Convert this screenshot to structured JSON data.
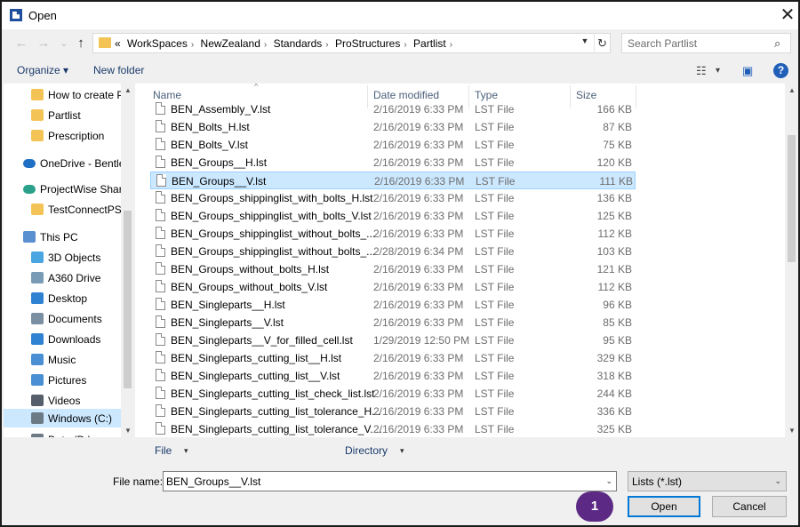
{
  "window": {
    "title": "Open",
    "close_glyph": "✕"
  },
  "nav_buttons": {
    "back": "←",
    "forward": "→",
    "recent": "⌄",
    "up": "↑"
  },
  "address": {
    "crumbs": [
      "WorkSpaces",
      "NewZealand",
      "Standards",
      "ProStructures",
      "Partlist"
    ],
    "overflow": "«",
    "refresh_glyph": "↻"
  },
  "search": {
    "placeholder": "Search Partlist",
    "icon_glyph": "⌕"
  },
  "toolbar": {
    "organize": "Organize ▾",
    "new_folder": "New folder",
    "view_glyph": "☷",
    "view_dd": "▾",
    "pane_glyph": "▣",
    "help": "?"
  },
  "sidebar": {
    "items": [
      {
        "label": "How to create Pr",
        "icon": "folder-icon",
        "color": "#f3c455"
      },
      {
        "label": "Partlist",
        "icon": "folder-icon",
        "color": "#f3c455"
      },
      {
        "label": "Prescription",
        "icon": "folder-icon",
        "color": "#f3c455"
      },
      {
        "label": "OneDrive - Bentley",
        "icon": "cloud-icon",
        "color": "#1f6fc4"
      },
      {
        "label": "ProjectWise Share",
        "icon": "cloud-icon",
        "color": "#2ba08a"
      },
      {
        "label": "TestConnectPS",
        "icon": "folder-icon",
        "color": "#f3c455"
      },
      {
        "label": "This PC",
        "icon": "computer-icon",
        "color": "#5a8fd0"
      },
      {
        "label": "3D Objects",
        "icon": "cube-icon",
        "color": "#4aa6e0"
      },
      {
        "label": "A360 Drive",
        "icon": "drive-icon",
        "color": "#7a9bb5"
      },
      {
        "label": "Desktop",
        "icon": "desktop-icon",
        "color": "#2f82d2"
      },
      {
        "label": "Documents",
        "icon": "documents-icon",
        "color": "#7b8fa3"
      },
      {
        "label": "Downloads",
        "icon": "download-icon",
        "color": "#2f82d2"
      },
      {
        "label": "Music",
        "icon": "music-icon",
        "color": "#4a8fd4"
      },
      {
        "label": "Pictures",
        "icon": "pictures-icon",
        "color": "#4a8fd4"
      },
      {
        "label": "Videos",
        "icon": "videos-icon",
        "color": "#555e6a"
      },
      {
        "label": "Windows (C:)",
        "icon": "hard-drive-icon",
        "color": "#6c7a86"
      },
      {
        "label": "Data (D:)",
        "icon": "hard-drive-icon",
        "color": "#6c7a86"
      }
    ],
    "selected_index": 15
  },
  "columns": {
    "name": "Name",
    "date": "Date modified",
    "type": "Type",
    "size": "Size",
    "sort_glyph": "^"
  },
  "files": [
    {
      "name": "BEN_Assembly_V.lst",
      "date": "2/16/2019 6:33 PM",
      "type": "LST File",
      "size": "166 KB"
    },
    {
      "name": "BEN_Bolts_H.lst",
      "date": "2/16/2019 6:33 PM",
      "type": "LST File",
      "size": "87 KB"
    },
    {
      "name": "BEN_Bolts_V.lst",
      "date": "2/16/2019 6:33 PM",
      "type": "LST File",
      "size": "75 KB"
    },
    {
      "name": "BEN_Groups__H.lst",
      "date": "2/16/2019 6:33 PM",
      "type": "LST File",
      "size": "120 KB"
    },
    {
      "name": "BEN_Groups__V.lst",
      "date": "2/16/2019 6:33 PM",
      "type": "LST File",
      "size": "111 KB"
    },
    {
      "name": "BEN_Groups_shippinglist_with_bolts_H.lst",
      "date": "2/16/2019 6:33 PM",
      "type": "LST File",
      "size": "136 KB"
    },
    {
      "name": "BEN_Groups_shippinglist_with_bolts_V.lst",
      "date": "2/16/2019 6:33 PM",
      "type": "LST File",
      "size": "125 KB"
    },
    {
      "name": "BEN_Groups_shippinglist_without_bolts_...",
      "date": "2/16/2019 6:33 PM",
      "type": "LST File",
      "size": "112 KB"
    },
    {
      "name": "BEN_Groups_shippinglist_without_bolts_...",
      "date": "2/28/2019 6:34 PM",
      "type": "LST File",
      "size": "103 KB"
    },
    {
      "name": "BEN_Groups_without_bolts_H.lst",
      "date": "2/16/2019 6:33 PM",
      "type": "LST File",
      "size": "121 KB"
    },
    {
      "name": "BEN_Groups_without_bolts_V.lst",
      "date": "2/16/2019 6:33 PM",
      "type": "LST File",
      "size": "112 KB"
    },
    {
      "name": "BEN_Singleparts__H.lst",
      "date": "2/16/2019 6:33 PM",
      "type": "LST File",
      "size": "96 KB"
    },
    {
      "name": "BEN_Singleparts__V.lst",
      "date": "2/16/2019 6:33 PM",
      "type": "LST File",
      "size": "85 KB"
    },
    {
      "name": "BEN_Singleparts__V_for_filled_cell.lst",
      "date": "1/29/2019 12:50 PM",
      "type": "LST File",
      "size": "95 KB"
    },
    {
      "name": "BEN_Singleparts_cutting_list__H.lst",
      "date": "2/16/2019 6:33 PM",
      "type": "LST File",
      "size": "329 KB"
    },
    {
      "name": "BEN_Singleparts_cutting_list__V.lst",
      "date": "2/16/2019 6:33 PM",
      "type": "LST File",
      "size": "318 KB"
    },
    {
      "name": "BEN_Singleparts_cutting_list_check_list.lst",
      "date": "2/16/2019 6:33 PM",
      "type": "LST File",
      "size": "244 KB"
    },
    {
      "name": "BEN_Singleparts_cutting_list_tolerance_H...",
      "date": "2/16/2019 6:33 PM",
      "type": "LST File",
      "size": "336 KB"
    },
    {
      "name": "BEN_Singleparts_cutting_list_tolerance_V....",
      "date": "2/16/2019 6:33 PM",
      "type": "LST File",
      "size": "325 KB"
    }
  ],
  "selected_file_index": 4,
  "filters": {
    "file": "File",
    "directory": "Directory",
    "dd": "▾"
  },
  "footer": {
    "file_name_label": "File name:",
    "file_name_value": "BEN_Groups__V.lst",
    "file_type": "Lists (*.lst)",
    "dd": "⌄",
    "open": "Open",
    "cancel": "Cancel",
    "step_badge": "1"
  },
  "colors": {
    "selection": "#cce8ff",
    "accent": "#0078d7",
    "badge": "#5c2a84"
  }
}
